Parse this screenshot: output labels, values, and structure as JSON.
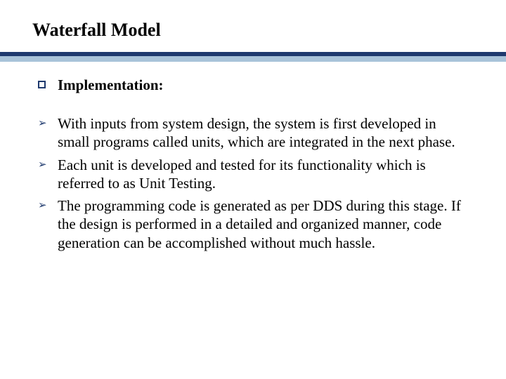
{
  "title": "Waterfall Model",
  "heading": {
    "bullet_glyph": "",
    "text": "Implementation:"
  },
  "items": [
    {
      "bullet_glyph": "➢",
      "text": "With inputs from system design, the system is first developed in small programs called units, which are integrated in the next phase."
    },
    {
      "bullet_glyph": "➢",
      "text": " Each unit is developed and tested for its functionality which is referred to as Unit Testing."
    },
    {
      "bullet_glyph": "➢",
      "text": " The programming code is generated as per DDS during this stage. If the design is performed in a detailed and organized manner, code generation can be accomplished without much hassle."
    }
  ],
  "colors": {
    "accent_dark": "#1f3a6e",
    "accent_light": "#a9c3d9"
  }
}
